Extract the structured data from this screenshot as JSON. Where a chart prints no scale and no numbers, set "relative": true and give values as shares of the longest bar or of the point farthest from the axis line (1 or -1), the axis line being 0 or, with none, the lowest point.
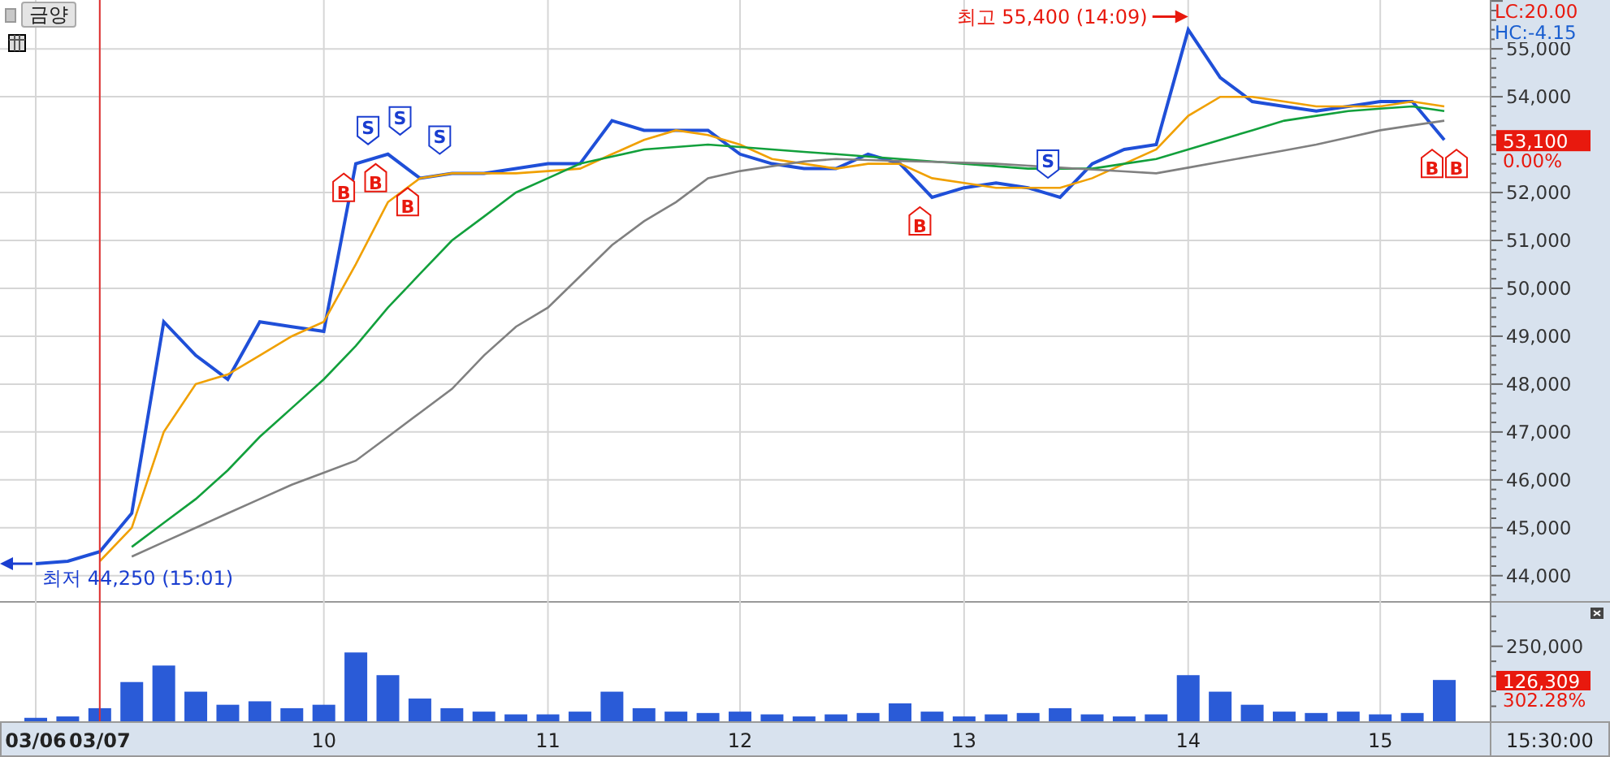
{
  "header": {
    "stock_name": "금양"
  },
  "price_chart": {
    "chart_data": {
      "type": "line",
      "categories": [
        "03/06",
        null,
        "03/07",
        null,
        null,
        null,
        null,
        null,
        null,
        "10",
        null,
        null,
        null,
        null,
        null,
        null,
        "11",
        null,
        null,
        null,
        null,
        null,
        "12",
        null,
        null,
        null,
        null,
        null,
        null,
        "13",
        null,
        null,
        null,
        null,
        null,
        null,
        "14",
        null,
        null,
        null,
        null,
        null,
        "15",
        null,
        null
      ],
      "ylim": [
        43470,
        56020
      ],
      "grid": true,
      "yticks": [
        {
          "value": 44000,
          "label": "44,000"
        },
        {
          "value": 45000,
          "label": "45,000"
        },
        {
          "value": 46000,
          "label": "46,000"
        },
        {
          "value": 47000,
          "label": "47,000"
        },
        {
          "value": 48000,
          "label": "48,000"
        },
        {
          "value": 49000,
          "label": "49,000"
        },
        {
          "value": 50000,
          "label": "50,000"
        },
        {
          "value": 51000,
          "label": "51,000"
        },
        {
          "value": 52000,
          "label": "52,000"
        },
        {
          "value": 54000,
          "label": "54,000"
        },
        {
          "value": 55000,
          "label": "55,000"
        }
      ],
      "series": [
        {
          "color": "#1f4fd8",
          "values": [
            44250,
            44300,
            44500,
            45300,
            49300,
            48600,
            48100,
            49300,
            49200,
            49100,
            52600,
            52800,
            52300,
            52400,
            52400,
            52500,
            52600,
            52600,
            53500,
            53300,
            53300,
            53300,
            52800,
            52600,
            52500,
            52500,
            52800,
            52600,
            51900,
            52100,
            52200,
            52100,
            51900,
            52600,
            52900,
            53000,
            55400,
            54400,
            53900,
            53800,
            53700,
            53800,
            53900,
            53900,
            53100
          ]
        },
        {
          "color": "#f0a000",
          "values": [
            null,
            null,
            44300,
            45000,
            47000,
            48000,
            48200,
            48600,
            49000,
            49300,
            50500,
            51800,
            52300,
            52400,
            52400,
            52400,
            52450,
            52500,
            52800,
            53100,
            53300,
            53200,
            53000,
            52700,
            52600,
            52500,
            52600,
            52600,
            52300,
            52200,
            52100,
            52100,
            52100,
            52300,
            52600,
            52900,
            53600,
            54000,
            54000,
            53900,
            53800,
            53800,
            53800,
            53900,
            53800
          ]
        },
        {
          "color": "#12a03c",
          "values": [
            null,
            null,
            null,
            44600,
            45100,
            45600,
            46200,
            46900,
            47500,
            48100,
            48800,
            49600,
            50300,
            51000,
            51500,
            52000,
            52300,
            52600,
            52750,
            52900,
            52950,
            53000,
            52950,
            52900,
            52850,
            52800,
            52750,
            52700,
            52650,
            52600,
            52550,
            52500,
            52500,
            52500,
            52600,
            52700,
            52900,
            53100,
            53300,
            53500,
            53600,
            53700,
            53750,
            53800,
            53700
          ]
        },
        {
          "color": "#808080",
          "values": [
            null,
            null,
            null,
            44400,
            44700,
            45000,
            45300,
            45600,
            45900,
            46150,
            46400,
            46900,
            47400,
            47900,
            48600,
            49200,
            49600,
            50250,
            50900,
            51400,
            51800,
            52300,
            52450,
            52550,
            52650,
            52700,
            52680,
            52660,
            52640,
            52620,
            52600,
            52560,
            52520,
            52480,
            52440,
            52400,
            52520,
            52640,
            52760,
            52880,
            53000,
            53150,
            53300,
            53400,
            53500
          ]
        }
      ],
      "ref_lines": [
        {
          "axis": "x",
          "value": "03/07",
          "color": "#e03030"
        }
      ],
      "annotations": [
        {
          "text": "최고 55,400 (14:09)"
        },
        {
          "text": "최저 44,250 (15:01)"
        }
      ]
    },
    "signals": [
      {
        "kind": "buy",
        "label": "B"
      },
      {
        "kind": "sell",
        "label": "S"
      },
      {
        "kind": "buy",
        "label": "B"
      },
      {
        "kind": "sell",
        "label": "S"
      },
      {
        "kind": "buy",
        "label": "B"
      },
      {
        "kind": "sell",
        "label": "S"
      },
      {
        "kind": "buy",
        "label": "B"
      },
      {
        "kind": "sell",
        "label": "S"
      },
      {
        "kind": "buy",
        "label": "B"
      },
      {
        "kind": "buy",
        "label": "B"
      }
    ],
    "lc": "LC:20.00",
    "hc": "HC:-4.15",
    "current_price": "53,100",
    "change": "0.00%"
  },
  "volume_chart": {
    "chart_data": {
      "type": "bar",
      "relative": true,
      "grid": true,
      "series": [
        {
          "color": "#2a5bd7",
          "values": [
            0.05,
            0.07,
            0.19,
            0.57,
            0.81,
            0.43,
            0.24,
            0.29,
            0.19,
            0.24,
            1,
            0.67,
            0.33,
            0.19,
            0.14,
            0.1,
            0.1,
            0.14,
            0.43,
            0.19,
            0.14,
            0.12,
            0.14,
            0.1,
            0.07,
            0.1,
            0.12,
            0.26,
            0.14,
            0.07,
            0.1,
            0.12,
            0.19,
            0.1,
            0.07,
            0.1,
            0.67,
            0.43,
            0.24,
            0.14,
            0.12,
            0.14,
            0.1,
            0.12,
            0.6
          ]
        }
      ],
      "annotations": [
        {
          "text": "250,000"
        }
      ]
    },
    "current_volume": "126,309",
    "change": "302.28%"
  },
  "time_axis": {
    "time": "15:30:00"
  }
}
